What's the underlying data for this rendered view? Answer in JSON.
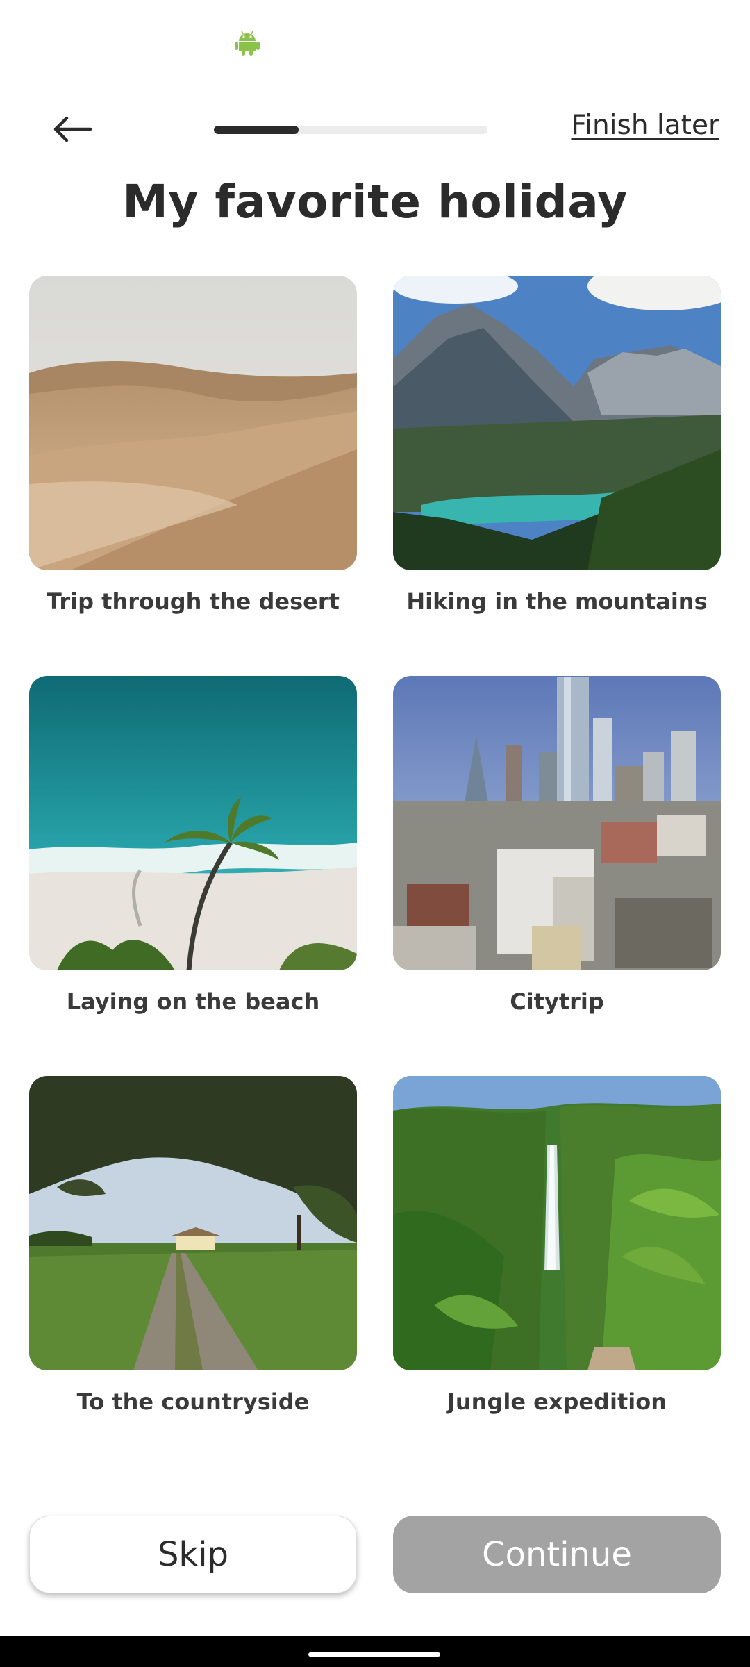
{
  "header": {
    "finish_later": "Finish later",
    "progress_fraction": 0.31
  },
  "page_title": "My favorite holiday",
  "options": [
    {
      "label": "Trip through the desert"
    },
    {
      "label": "Hiking in the mountains"
    },
    {
      "label": "Laying on the beach"
    },
    {
      "label": "Citytrip"
    },
    {
      "label": "To the countryside"
    },
    {
      "label": "Jungle expedition"
    }
  ],
  "buttons": {
    "skip": "Skip",
    "continue": "Continue"
  },
  "icons": {
    "status": "android-icon",
    "back": "arrow-left-icon"
  },
  "colors": {
    "android_green": "#8bc34a",
    "text_dark": "#2b2b2b",
    "continue_disabled": "#a3a3a3"
  }
}
